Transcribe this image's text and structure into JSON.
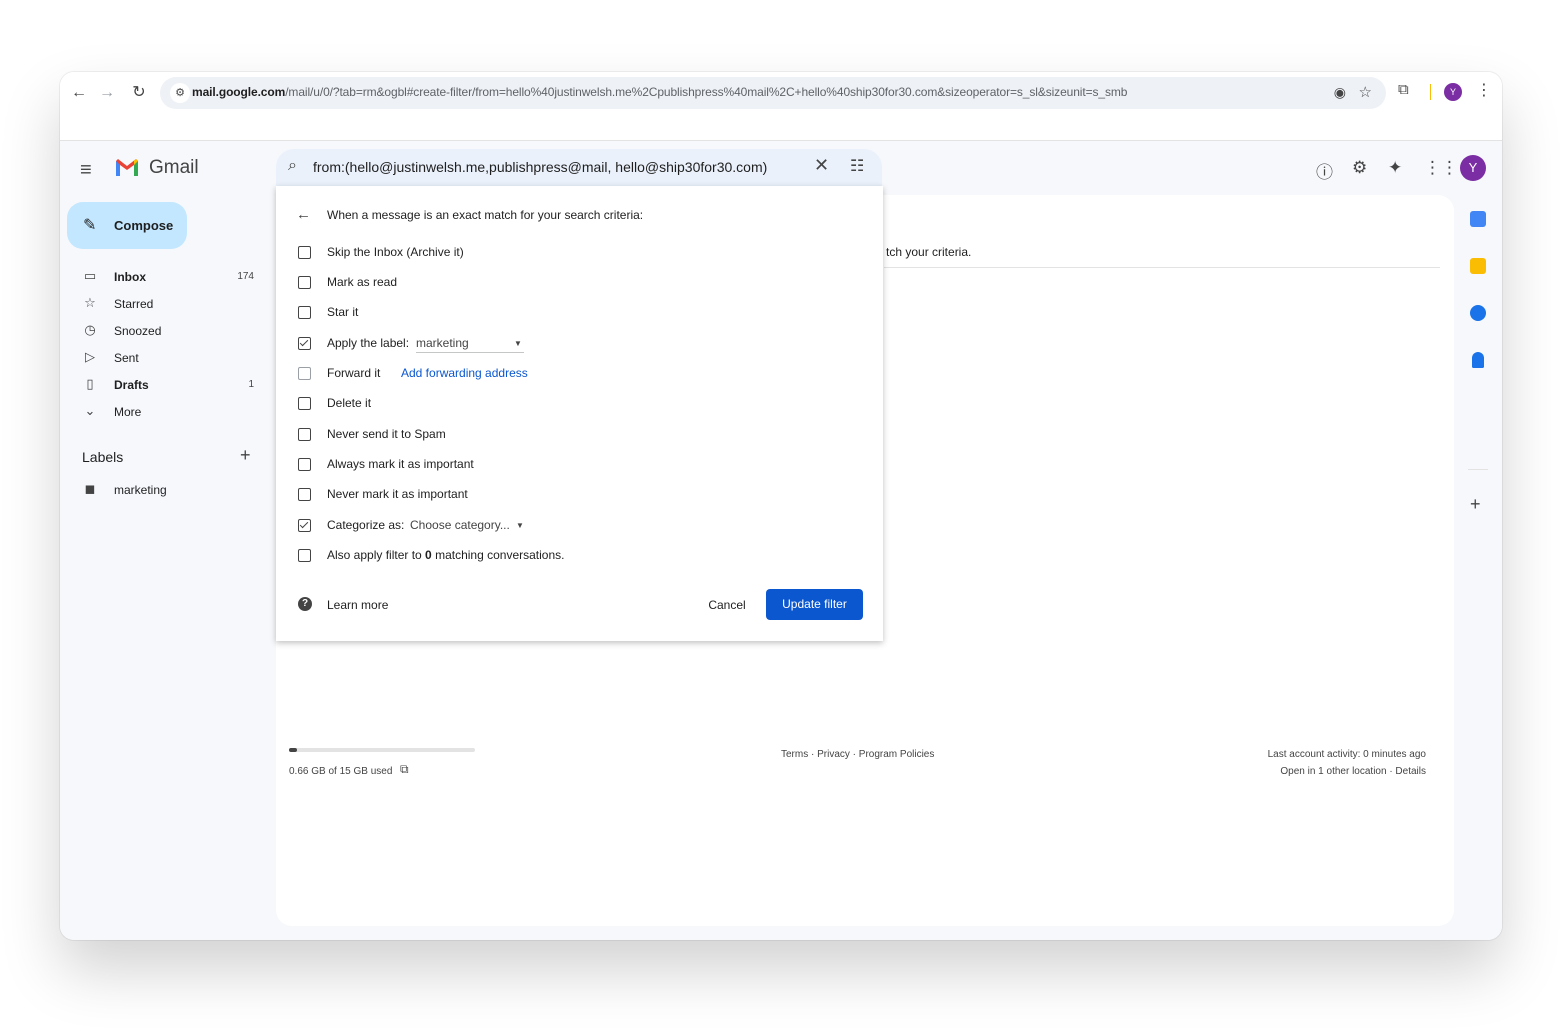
{
  "browser": {
    "url_host": "mail.google.com",
    "url_path": "/mail/u/0/?tab=rm&ogbl#create-filter/from=hello%40justinwelsh.me%2Cpublishpress%40mail%2C+hello%40ship30for30.com&sizeoperator=s_sl&sizeunit=s_smb",
    "avatar_letter": "Y"
  },
  "gmail": {
    "logo_text": "Gmail",
    "search_query": "from:(hello@justinwelsh.me,publishpress@mail, hello@ship30for30.com)",
    "avatar_letter": "Y",
    "compose_label": "Compose",
    "nav": [
      {
        "label": "Inbox",
        "count": "174",
        "icon": "inbox-icon"
      },
      {
        "label": "Starred",
        "count": "",
        "icon": "star-icon"
      },
      {
        "label": "Snoozed",
        "count": "",
        "icon": "clock-icon"
      },
      {
        "label": "Sent",
        "count": "",
        "icon": "send-icon"
      },
      {
        "label": "Drafts",
        "count": "1",
        "icon": "file-icon"
      },
      {
        "label": "More",
        "count": "",
        "icon": "chevron-down-icon"
      }
    ],
    "labels_title": "Labels",
    "labels": [
      {
        "label": "marketing"
      }
    ],
    "main_criteria_text": "tch your criteria.",
    "storage": {
      "text": "0.66 GB of 15 GB used",
      "fraction": 0.044
    },
    "footer_center": "Terms · Privacy · Program Policies",
    "footer_right_1": "Last account activity: 0 minutes ago",
    "footer_right_2": "Open in 1 other location · Details"
  },
  "filter": {
    "heading": "When a message is an exact match for your search criteria:",
    "options": [
      {
        "label": "Skip the Inbox (Archive it)",
        "checked": false
      },
      {
        "label": "Mark as read",
        "checked": false
      },
      {
        "label": "Star it",
        "checked": false
      },
      {
        "label": "Apply the label:",
        "checked": true,
        "value": "marketing"
      },
      {
        "label": "Forward it",
        "checked": false,
        "link": "Add forwarding address"
      },
      {
        "label": "Delete it",
        "checked": false
      },
      {
        "label": "Never send it to Spam",
        "checked": false
      },
      {
        "label": "Always mark it as important",
        "checked": false
      },
      {
        "label": "Never mark it as important",
        "checked": false
      },
      {
        "label": "Categorize as:",
        "checked": true,
        "value": "Choose category..."
      },
      {
        "label_before": "Also apply filter to ",
        "label_bold": "0",
        "label_after": " matching conversations.",
        "checked": false
      }
    ],
    "learn_more": "Learn more",
    "cancel": "Cancel",
    "update": "Update filter"
  },
  "colors": {
    "accent": "#0b57d0",
    "compose_bg": "#c2e7ff",
    "avatar": "#7b2da3"
  }
}
